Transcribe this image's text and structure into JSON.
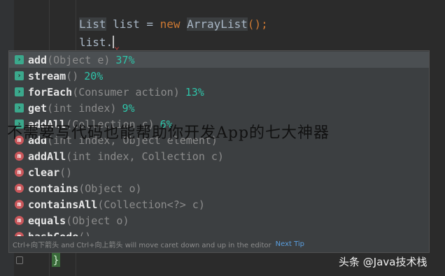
{
  "editor": {
    "line1": {
      "type1": "List",
      "var": " list = ",
      "kw_new": "new",
      "space": " ",
      "type2": "ArrayList",
      "tail": "();"
    },
    "line2": "list."
  },
  "completion": {
    "items": [
      {
        "icon": "lambda-icon",
        "name": "add",
        "sig": "(Object e)",
        "pct": "37%"
      },
      {
        "icon": "lambda-icon",
        "name": "stream",
        "sig": "()",
        "pct": "20%"
      },
      {
        "icon": "lambda-icon",
        "name": "forEach",
        "sig": "(Consumer action)",
        "pct": "13%"
      },
      {
        "icon": "lambda-icon",
        "name": "get",
        "sig": "(int index)",
        "pct": "9%"
      },
      {
        "icon": "lambda-icon",
        "name": "addAll",
        "sig": "(Collection c)",
        "pct": "6%"
      },
      {
        "icon": "method-icon",
        "name": "add",
        "sig": "(int index, Object element)",
        "pct": ""
      },
      {
        "icon": "method-icon",
        "name": "addAll",
        "sig": "(int index, Collection c)",
        "pct": ""
      },
      {
        "icon": "method-icon",
        "name": "clear",
        "sig": "()",
        "pct": ""
      },
      {
        "icon": "method-icon",
        "name": "contains",
        "sig": "(Object o)",
        "pct": ""
      },
      {
        "icon": "method-icon",
        "name": "containsAll",
        "sig": "(Collection<?> c)",
        "pct": ""
      },
      {
        "icon": "method-icon",
        "name": "equals",
        "sig": "(Object o)",
        "pct": ""
      },
      {
        "icon": "method-icon",
        "name": "hashCode",
        "sig": "()",
        "pct": ""
      }
    ],
    "footer_hint": "Ctrl+向下箭头 and Ctrl+向上箭头 will move caret down and up in the editor",
    "footer_link": "Next Tip"
  },
  "overlay_title": "不需要写代码也能帮助你开发App的七大神器",
  "closing_brace": "}",
  "watermark": "头条 @Java技术栈",
  "colors": {
    "editor_bg": "#2b2b2b",
    "popup_bg": "#3c3f41",
    "selected_row": "#4b4f52",
    "percent": "#2ec4a9",
    "keyword": "#cc7832"
  }
}
